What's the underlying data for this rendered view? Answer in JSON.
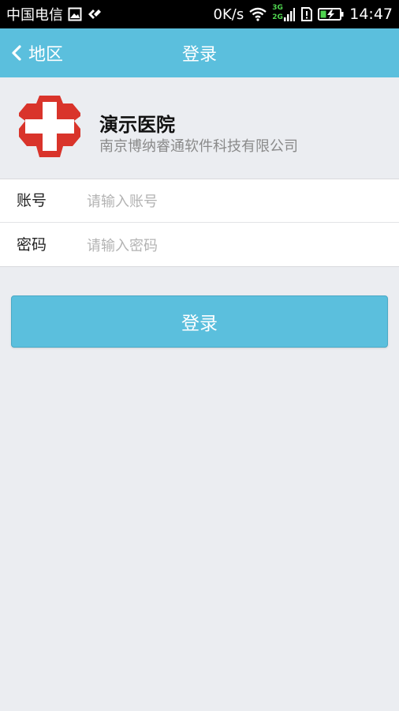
{
  "status_bar": {
    "carrier": "中国电信",
    "net_speed": "0K/s",
    "net_type_top": "3G",
    "net_type_bottom": "2G",
    "time": "14:47"
  },
  "title_bar": {
    "back_label": "地区",
    "title": "登录",
    "background_color": "#5bbfdd"
  },
  "hospital": {
    "name": "演示医院",
    "company": "南京博纳睿通软件科技有限公司",
    "logo_color": "#d9342b"
  },
  "form": {
    "account": {
      "label": "账号",
      "placeholder": "请输入账号",
      "value": ""
    },
    "password": {
      "label": "密码",
      "placeholder": "请输入密码",
      "value": ""
    }
  },
  "login_button": {
    "label": "登录"
  }
}
